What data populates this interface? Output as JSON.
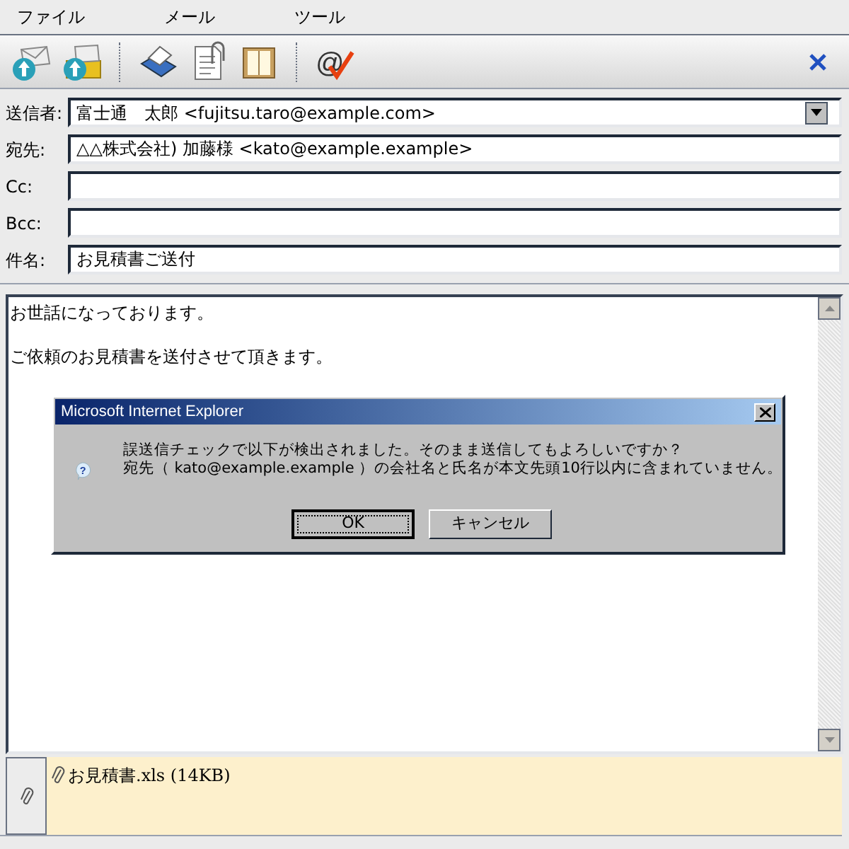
{
  "menu": [
    "ファイル",
    "メール",
    "ツール"
  ],
  "fields": [
    {
      "label": "送信者:",
      "value": "富士通　太郎 <fujitsu.taro@example.com>",
      "kind": "dropdown"
    },
    {
      "label": "宛先:",
      "value": "△△株式会社) 加藤様 <kato@example.example>",
      "kind": "text"
    },
    {
      "label": "Cc:",
      "kind": "text"
    },
    {
      "label": "Bcc:",
      "kind": "text"
    },
    {
      "label": "件名:",
      "value": "お見積書ご送付",
      "kind": "text"
    }
  ],
  "body": [
    "お世話になっております。",
    "ご依頼のお見積書を送付させて頂きます。"
  ],
  "dialog": {
    "title": "Microsoft Internet Explorer",
    "message": [
      "誤送信チェックで以下が検出されました。そのまま送信してもよろしいですか？",
      "宛先（ kato@example.example ）の会社名と氏名が本文先頭10行以内に含まれていません。"
    ],
    "buttons": [
      {
        "label": "OK",
        "selected": true
      },
      {
        "label": "キャンセル",
        "selected": false
      }
    ]
  },
  "toolbar_symbol": "@",
  "dialog_symbol": "?",
  "attachments": [
    "お見積書.xls (14KB)"
  ]
}
